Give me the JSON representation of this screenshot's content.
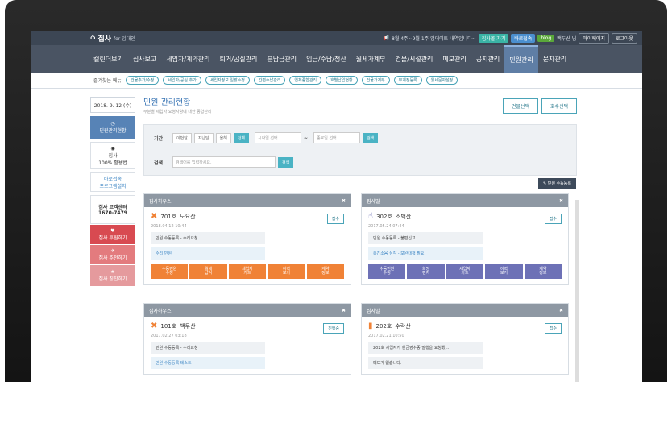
{
  "topbar": {
    "logo": "집사",
    "logo_sub": "for 임대인",
    "notice": "8월 4주~9월 1주 업데이트 내역입니다~",
    "btn_site": "집사몰 가기",
    "btn_fav": "바로접속",
    "btn_blog": "blog",
    "user": "백두산 님",
    "btn_mypage": "마이페이지",
    "btn_logout": "로그아웃"
  },
  "nav": [
    "캘린더보기",
    "집사보고",
    "세입자/계약관리",
    "퇴거/공실관리",
    "분납금관리",
    "입금/수납/정산",
    "월세가계부",
    "건물/시설관리",
    "메모관리",
    "공지관리",
    "민원관리",
    "문자관리"
  ],
  "quick": {
    "label": "즐겨찾는 메뉴",
    "items": [
      "건물추가/수정",
      "세입자/공실 추가",
      "세입자정보 일괄수정",
      "간편수납관리",
      "연체종합관리",
      "호별납입현황",
      "건물가계부",
      "부계정등록",
      "월세문자설정"
    ]
  },
  "left": {
    "date": "2018. 9. 12 (수)",
    "current": "민원관리현황",
    "chrome": "집사\n100% 활용법",
    "visit": "바로접속\n프로그램설치",
    "cs": "집사 고객센터\n1670-7479",
    "r1": "집사 후원하기",
    "r2": "집사 추천하기",
    "r3": "집사 칭찬하기"
  },
  "page": {
    "title": "민원 관리현황",
    "subtitle": "부분별 세입자 요청사항에 대한 종합관리",
    "btn_building": "건물선택",
    "btn_room": "호수선택",
    "period_label": "기간",
    "periods": [
      "이번달",
      "지난달",
      "올해",
      "전체"
    ],
    "start_ph": "시작일 선택",
    "end_ph": "종료일 선택",
    "search_btn": "검색",
    "search_label": "검색",
    "search_ph": "검색어를 입력하세요.",
    "reg_btn": "민원 수동등록"
  },
  "cards": [
    {
      "building": "집사하우스",
      "room": "701호",
      "name": "도요산",
      "date": "2018.04.12 10:44",
      "line1": "민원 수동등록 - 수리요청",
      "line2": "수리 민원",
      "status": "접수"
    },
    {
      "building": "집사빌",
      "room": "302호",
      "name": "소백산",
      "date": "2017.05.24 07:44",
      "line1": "민원 수동등록 - 불편신고",
      "line2": "층간소음 심각 - 보완대책 필요",
      "status": "접수"
    },
    {
      "building": "집사하우스",
      "room": "101호",
      "name": "백두산",
      "date": "2017.02.27 03:18",
      "line1": "민원 수동등록 - 수리요청",
      "line2": "민원 수동등록 테스트",
      "status": "진행중"
    },
    {
      "building": "집사빌",
      "room": "202호",
      "name": "수락산",
      "date": "2017.02.21 10:50",
      "line1": "202호 세입자가 현금영수증 발행을 요청했...",
      "line2": "메모가 없습니다.",
      "status": "접수"
    }
  ],
  "actions": [
    "수동민원\n수정",
    "월세\n납식",
    "세입자\n카드",
    "이력\n보기",
    "계약\n정보"
  ],
  "actions2": [
    "수동민원\n수정",
    "희망\n편지",
    "세입자\n카드",
    "이력\n보기",
    "계약\n정보"
  ]
}
